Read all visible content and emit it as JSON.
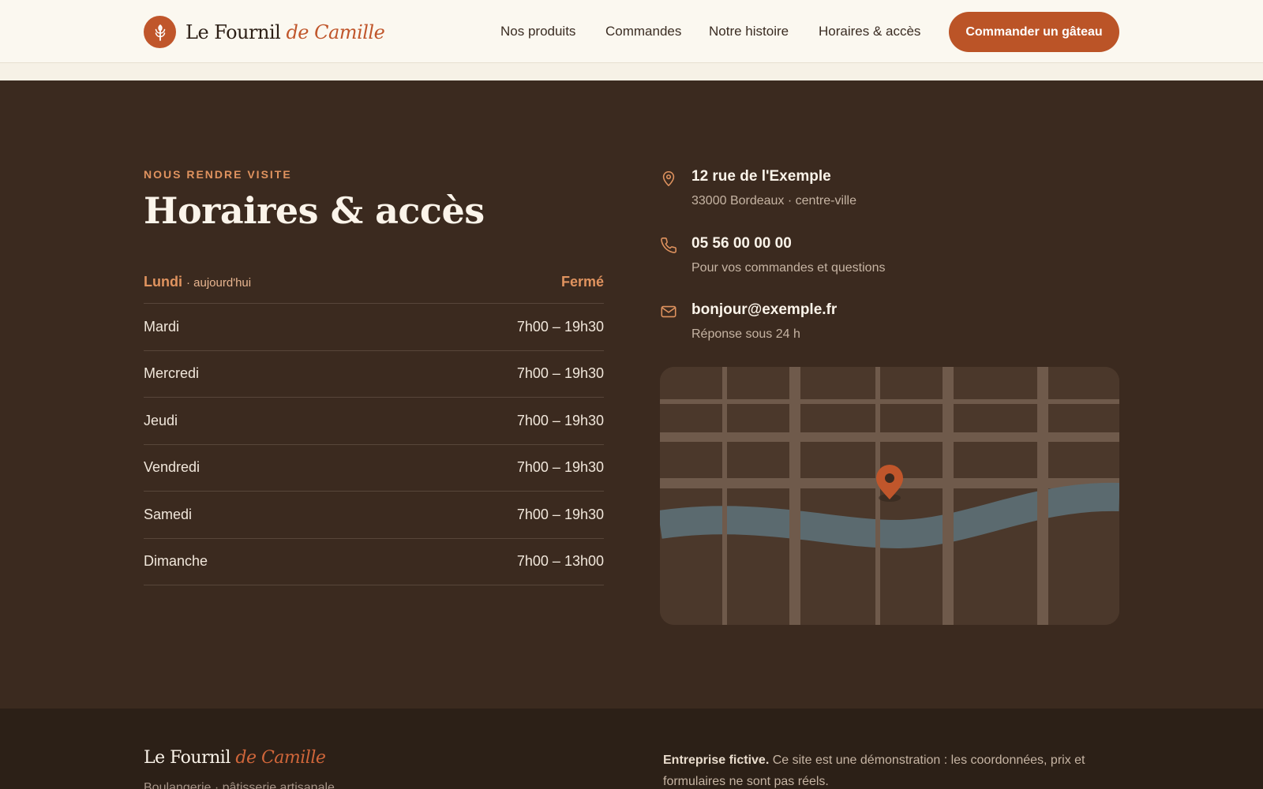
{
  "header": {
    "brand_main": "Le Fournil",
    "brand_accent": "de Camille",
    "nav": [
      "Nos produits",
      "Commandes",
      "Notre histoire",
      "Horaires & accès"
    ],
    "cta": "Commander un gâteau",
    "logo_icon": "wheat-icon"
  },
  "section": {
    "eyebrow": "NOUS RENDRE VISITE",
    "title": "Horaires & accès",
    "hours": [
      {
        "day": "Lundi",
        "note": "· aujourd'hui",
        "time": "Fermé"
      },
      {
        "day": "Mardi",
        "time": "7h00 – 19h30"
      },
      {
        "day": "Mercredi",
        "time": "7h00 – 19h30"
      },
      {
        "day": "Jeudi",
        "time": "7h00 – 19h30"
      },
      {
        "day": "Vendredi",
        "time": "7h00 – 19h30"
      },
      {
        "day": "Samedi",
        "time": "7h00 – 19h30"
      },
      {
        "day": "Dimanche",
        "time": "7h00 – 13h00"
      }
    ],
    "contacts": [
      {
        "icon": "map-pin-icon",
        "title": "12 rue de l'Exemple",
        "sub": "33000 Bordeaux · centre-ville"
      },
      {
        "icon": "phone-icon",
        "title": "05 56 00 00 00",
        "sub": "Pour vos commandes et questions"
      },
      {
        "icon": "mail-icon",
        "title": "bonjour@exemple.fr",
        "sub": "Réponse sous 24 h"
      }
    ]
  },
  "footer": {
    "brand_main": "Le Fournil",
    "brand_accent": "de Camille",
    "tagline": "Boulangerie · pâtisserie artisanale",
    "note_bold": "Entreprise fictive.",
    "note_text": " Ce site est une démonstration : les coordonnées, prix et formulaires ne sont pas réels."
  },
  "colors": {
    "accent": "#c0562b",
    "dark_bg": "#3b2a1f",
    "cream": "#fbf8f0",
    "highlight": "#e0935f"
  }
}
